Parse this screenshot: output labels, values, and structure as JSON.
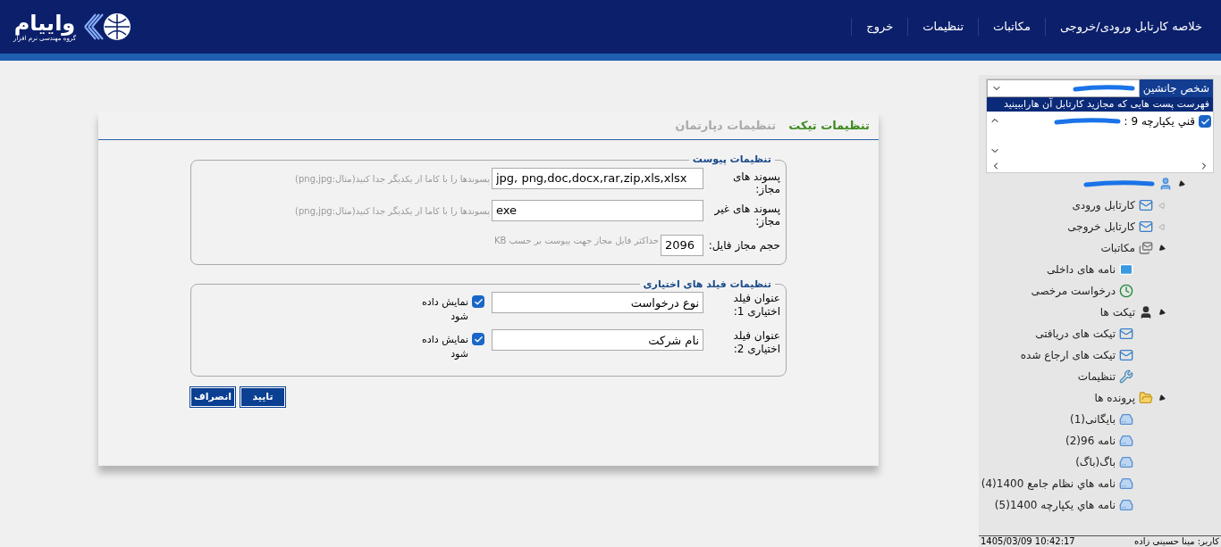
{
  "header": {
    "logo": {
      "name": "واییام",
      "tagline": "گروه مهندسی نرم افزار"
    },
    "menu": [
      {
        "label": "خلاصه کارتابل ورودی/خروجی"
      },
      {
        "label": "مکاتبات"
      },
      {
        "label": "تنظیمات"
      },
      {
        "label": "خروج"
      }
    ]
  },
  "tabs": [
    {
      "label": "تنظیمات تیکت",
      "selected": true
    },
    {
      "label": "تنظیمات دپارتمان",
      "selected": false
    }
  ],
  "attachments": {
    "legend": "تنظیمات پیوست",
    "rows": [
      {
        "label": "پسوند های مجاز:",
        "value": "jpg, png,doc,docx,rar,zip,xls,xlsx",
        "hint": "پسوندها را با کاما از یکدیگر جدا کنید(مثال:png,jpg)"
      },
      {
        "label": "پسوند های غیر مجاز:",
        "value": "exe",
        "hint": "پسوندها را با کاما از یکدیگر جدا کنید(مثال:png,jpg)"
      }
    ],
    "size": {
      "label": "حجم مجاز فایل:",
      "value": "2096",
      "hint": "حداکثر فایل مجاز جهت پیوست بر حسب KB"
    }
  },
  "optional_fields": {
    "legend": "تنظیمات فیلد های اختیاری",
    "rows": [
      {
        "label": "عنوان فیلد اختیاری 1:",
        "value": "نوع درخواست",
        "checkbox_label": "نمایش داده شود",
        "checked": true
      },
      {
        "label": "عنوان فیلد اختیاری 2:",
        "value": "نام شرکت",
        "checkbox_label": "نمایش داده شود",
        "checked": true
      }
    ]
  },
  "buttons": [
    {
      "label": "تایید"
    },
    {
      "label": "انصراف"
    }
  ],
  "sidebar": {
    "substitute": {
      "label": "شخص جانشین",
      "list_title": "فهرست پست هایی که مجازید کارتابل آن هاراببینید",
      "items": [
        {
          "label": "قني يکپارچه 9 :",
          "checked": true
        }
      ]
    },
    "tree": [
      {
        "kind": "user",
        "expanded": true,
        "children": [
          {
            "kind": "inbox",
            "label": "کارتابل ورودی",
            "expanded": false
          },
          {
            "kind": "outbox",
            "label": "کارتابل خروجی",
            "expanded": false
          },
          {
            "kind": "letters",
            "label": "مکاتبات",
            "expanded": true,
            "children": [
              {
                "kind": "mail",
                "label": "نامه های داخلی"
              },
              {
                "kind": "leave",
                "label": "درخواست مرخصی"
              }
            ]
          },
          {
            "kind": "tickets",
            "label": "تیکت ها",
            "expanded": true,
            "children": [
              {
                "kind": "inbox",
                "label": "تیکت های دریافتی"
              },
              {
                "kind": "outbox",
                "label": "تیکت های ارجاع شده"
              },
              {
                "kind": "tools",
                "label": "تنظیمات"
              }
            ]
          },
          {
            "kind": "folders",
            "label": "پرونده ها",
            "expanded": true,
            "children": [
              {
                "kind": "drawer",
                "label": "بایگانی(1)"
              },
              {
                "kind": "drawer",
                "label": "نامه 96(2)"
              },
              {
                "kind": "drawer",
                "label": "باگ(باگ)"
              },
              {
                "kind": "drawer",
                "label": "نامه هاي نظام جامع 1400(4)"
              },
              {
                "kind": "drawer",
                "label": "نامه هاي يکپارچه 1400(5)"
              }
            ]
          }
        ]
      }
    ],
    "footer": {
      "datetime": "1405/03/09 10:42:17",
      "user": "کاربر: مینا حسینی زاده"
    }
  }
}
